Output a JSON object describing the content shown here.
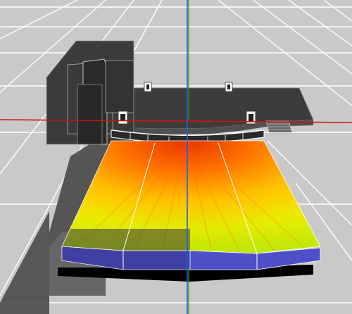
{
  "viewport": {
    "background": "#c9c9c9",
    "grid_color": "#ffffff"
  },
  "axes": {
    "x_axis_color": "#d01010",
    "y_axis_color": "#2060e0",
    "z_axis_color": "#10a010"
  },
  "model": {
    "wall_color": "#2e2e2e",
    "stage_color": "#3a3a3a",
    "edge_color": "#9a9a9a",
    "audience_side_color": "#4f4fc9",
    "audience_base_color": "#000000",
    "heatmap_colors": [
      "#f0f000",
      "#ffd000",
      "#ff8000",
      "#ee3a00"
    ]
  },
  "objects": {
    "loudspeakers": [
      "speaker-icon",
      "speaker-icon",
      "speaker-icon",
      "speaker-icon"
    ]
  }
}
